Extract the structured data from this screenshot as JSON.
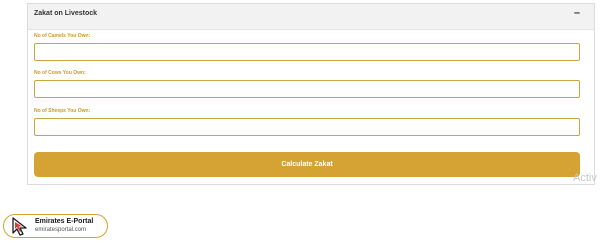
{
  "panel": {
    "title": "Zakat on Livestock",
    "collapse_symbol": "–"
  },
  "fields": [
    {
      "label": "No of Camels You Own:",
      "value": "",
      "placeholder": ""
    },
    {
      "label": "No of Cows You Own:",
      "value": "",
      "placeholder": ""
    },
    {
      "label": "No of Sheeps You Own:",
      "value": "",
      "placeholder": ""
    }
  ],
  "button": {
    "label": "Calculate Zakat"
  },
  "overlay_text": "Activ",
  "logo": {
    "name": "Emirates E-Portal",
    "url": "emiratesportal.com",
    "icon": "cursor-arrow-icon"
  },
  "colors": {
    "accent": "#d4a334",
    "label": "#c99b2c",
    "header_bg": "#f2f2f2",
    "border": "#c9a53f"
  }
}
